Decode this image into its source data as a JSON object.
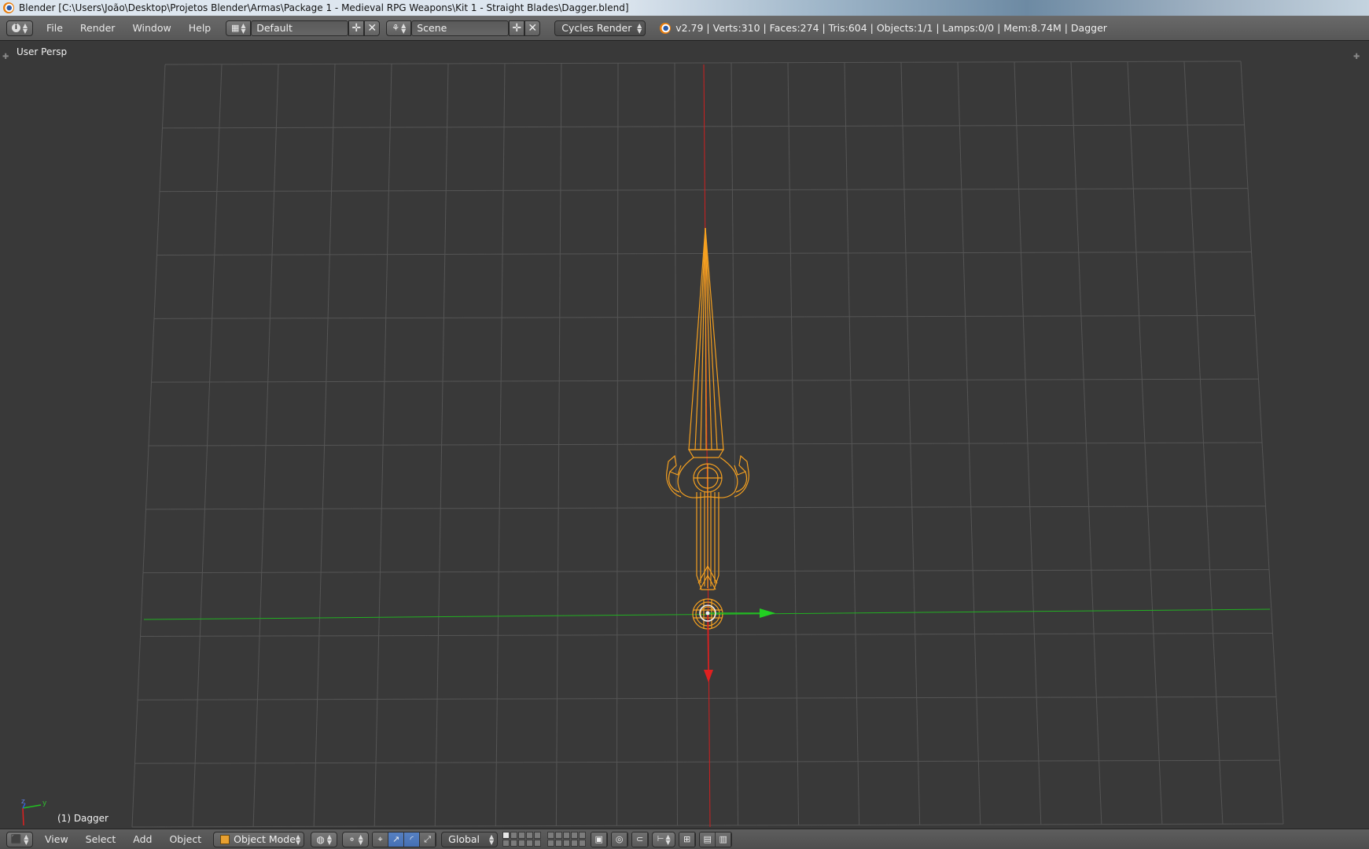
{
  "window": {
    "title": "Blender [C:\\Users\\João\\Desktop\\Projetos Blender\\Armas\\Package 1 - Medieval RPG Weapons\\Kit 1 - Straight Blades\\Dagger.blend]"
  },
  "info_header": {
    "editor_icon": "info-icon",
    "menus": [
      "File",
      "Render",
      "Window",
      "Help"
    ],
    "screen_layout": "Default",
    "scene": "Scene",
    "render_engine": "Cycles Render",
    "stats": "v2.79 | Verts:310 | Faces:274 | Tris:604 | Objects:1/1 | Lamps:0/0 | Mem:8.74M | Dagger"
  },
  "viewport": {
    "view_label": "User Persp",
    "object_label": "(1) Dagger",
    "axis_x_color": "#e02020",
    "axis_y_color": "#22c022",
    "selection_color": "#f5a020",
    "grid_color": "#555555",
    "widget_axes": [
      "z",
      "y"
    ]
  },
  "bottom_header": {
    "editor_icon": "3d-view-icon",
    "menus": [
      "View",
      "Select",
      "Add",
      "Object"
    ],
    "mode": "Object Mode",
    "transform_orientation": "Global",
    "icons": [
      "viewport-shading-icon",
      "pivot-point-icon",
      "manipulator-toggle-icon",
      "translate-icon",
      "rotate-icon",
      "scale-icon",
      "layers-grid",
      "lock-icon",
      "proportional-edit-icon",
      "snap-icon",
      "snap-target-icon",
      "opengl-render-icon",
      "opengl-anim-icon"
    ]
  }
}
